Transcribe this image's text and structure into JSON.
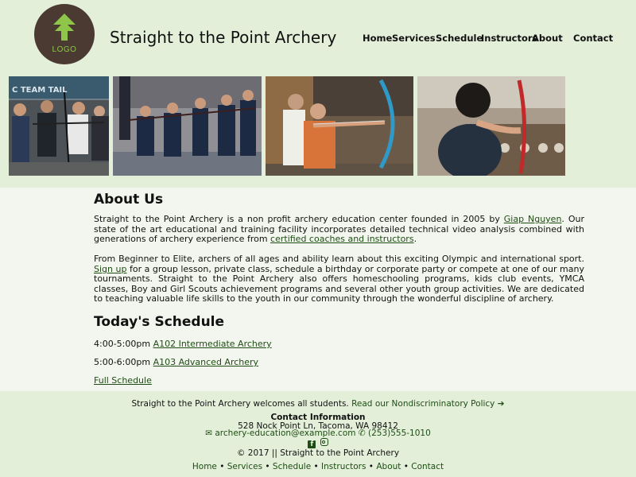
{
  "header": {
    "logo_text": "LOGO",
    "title": "Straight to the Point Archery",
    "nav": [
      "Home",
      "Services",
      "Schedule",
      "Instructors",
      "About",
      "Contact"
    ]
  },
  "photos": [
    {
      "name": "team-photo"
    },
    {
      "name": "kids-archery-photo"
    },
    {
      "name": "aiming-archers-photo"
    },
    {
      "name": "indoor-range-photo"
    }
  ],
  "about": {
    "heading": "About Us",
    "p1_a": "Straight to the Point Archery is a non profit archery education center founded in 2005 by ",
    "p1_link": "Giap Nguyen",
    "p1_b": ". Our state of the art educational and training facility incorporates detailed technical video analysis combined with generations of archery experience from ",
    "p1_link2": "certified coaches and instructors",
    "p1_c": ".",
    "p2_a": "From Beginner to Elite, archers of all ages and ability learn about this exciting Olympic and international sport. ",
    "p2_link": "Sign up",
    "p2_b": " for a group lesson, private class, schedule a birthday or corporate party or compete at one of our many tournaments. Straight to the Point Archery also offers homeschooling programs, kids club events, YMCA classes, Boy and Girl Scouts achievement programs and several other youth group activities. We are dedicated to teaching valuable life skills to the youth in our community through the wonderful discipline of archery."
  },
  "schedule": {
    "heading": "Today's Schedule",
    "items": [
      {
        "time": "4:00-5:00pm ",
        "class": "A102 Intermediate Archery"
      },
      {
        "time": "5:00-6:00pm ",
        "class": "A103 Advanced Archery"
      }
    ],
    "full_link": "Full Schedule"
  },
  "footer": {
    "welcome": "Straight to the Point Archery welcomes all students. ",
    "policy_link": "Read our Nondiscriminatory Policy",
    "contact_heading": "Contact Information",
    "address": "528 Nock Point Ln, Tacoma, WA 98412",
    "email": "archery-education@example.com",
    "phone": "(253)555-1010",
    "copyright": "© 2017 || Straight to the Point Archery",
    "links": [
      "Home",
      "Services",
      "Schedule",
      "Instructors",
      "About",
      "Contact"
    ],
    "separator": " • "
  },
  "colors": {
    "accent": "#1e4d14",
    "header_bg": "#e3efd9",
    "main_bg": "#f3f6ee",
    "logo_bg": "#4b3a32",
    "logo_green": "#8ec64a"
  }
}
